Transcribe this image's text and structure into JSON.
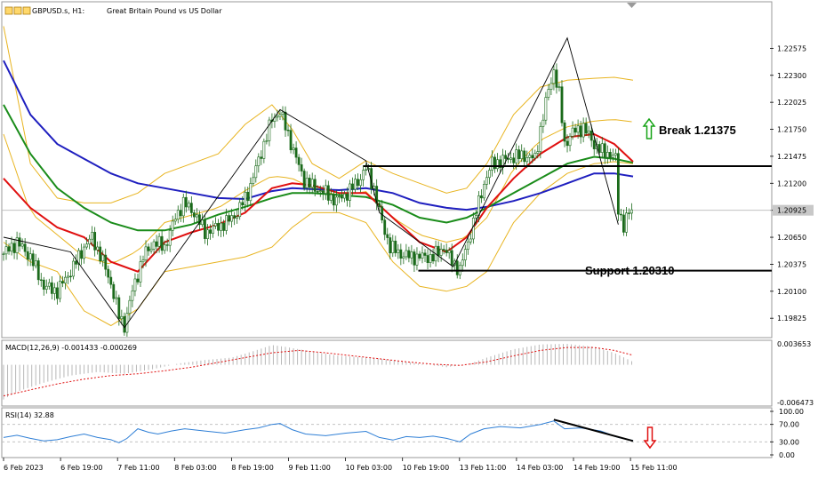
{
  "chart_data": {
    "type": "candlestick",
    "header": {
      "symbol": "GBPUSD.s, H1:",
      "description": "Great Britain Pound vs US Dollar"
    },
    "price_axis": {
      "ticks": [
        "1.22575",
        "1.22300",
        "1.22025",
        "1.21750",
        "1.21475",
        "1.21200",
        "1.20925",
        "1.20650",
        "1.20375",
        "1.20100",
        "1.19825"
      ],
      "ylim": [
        1.197,
        1.2285
      ],
      "current_price": "1.20925",
      "current_value": 1.20925
    },
    "time_axis": {
      "labels": [
        "6 Feb 2023",
        "6 Feb 19:00",
        "7 Feb 11:00",
        "8 Feb 03:00",
        "8 Feb 19:00",
        "9 Feb 11:00",
        "10 Feb 03:00",
        "10 Feb 19:00",
        "13 Feb 11:00",
        "14 Feb 03:00",
        "14 Feb 19:00",
        "15 Feb 11:00"
      ]
    },
    "close_path": [
      [
        0,
        1.2048
      ],
      [
        10,
        1.206
      ],
      [
        20,
        1.2045
      ],
      [
        30,
        1.2015
      ],
      [
        40,
        1.201
      ],
      [
        52,
        1.2035
      ],
      [
        60,
        1.2055
      ],
      [
        66,
        1.2065
      ],
      [
        74,
        1.204
      ],
      [
        80,
        1.2018
      ],
      [
        86,
        1.1985
      ],
      [
        90,
        1.1975
      ],
      [
        96,
        1.201
      ],
      [
        104,
        1.2045
      ],
      [
        112,
        1.206
      ],
      [
        120,
        1.2055
      ],
      [
        128,
        1.2085
      ],
      [
        134,
        1.21
      ],
      [
        142,
        1.209
      ],
      [
        150,
        1.207
      ],
      [
        158,
        1.2075
      ],
      [
        166,
        1.208
      ],
      [
        174,
        1.209
      ],
      [
        182,
        1.211
      ],
      [
        188,
        1.2135
      ],
      [
        194,
        1.216
      ],
      [
        200,
        1.2185
      ],
      [
        206,
        1.2193
      ],
      [
        212,
        1.217
      ],
      [
        218,
        1.2145
      ],
      [
        224,
        1.2123
      ],
      [
        232,
        1.2115
      ],
      [
        240,
        1.211
      ],
      [
        248,
        1.2102
      ],
      [
        256,
        1.211
      ],
      [
        264,
        1.2122
      ],
      [
        270,
        1.2135
      ],
      [
        276,
        1.2115
      ],
      [
        282,
        1.208
      ],
      [
        288,
        1.2055
      ],
      [
        296,
        1.2048
      ],
      [
        304,
        1.2045
      ],
      [
        312,
        1.2045
      ],
      [
        320,
        1.2045
      ],
      [
        328,
        1.2055
      ],
      [
        334,
        1.204
      ],
      [
        340,
        1.2032
      ],
      [
        346,
        1.206
      ],
      [
        352,
        1.209
      ],
      [
        358,
        1.212
      ],
      [
        364,
        1.214
      ],
      [
        372,
        1.2143
      ],
      [
        380,
        1.2147
      ],
      [
        388,
        1.2148
      ],
      [
        396,
        1.2145
      ],
      [
        400,
        1.2175
      ],
      [
        406,
        1.2215
      ],
      [
        410,
        1.2235
      ],
      [
        414,
        1.221
      ],
      [
        418,
        1.216
      ],
      [
        424,
        1.2172
      ],
      [
        432,
        1.2177
      ],
      [
        440,
        1.216
      ],
      [
        446,
        1.2152
      ],
      [
        452,
        1.215
      ],
      [
        456,
        1.2145
      ],
      [
        458,
        1.2092
      ],
      [
        462,
        1.2078
      ],
      [
        466,
        1.209
      ],
      [
        469,
        1.2093
      ]
    ],
    "zigzag": [
      [
        0,
        1.2065
      ],
      [
        50,
        1.205
      ],
      [
        90,
        1.1973
      ],
      [
        206,
        1.2195
      ],
      [
        270,
        1.2143
      ],
      [
        280,
        1.209
      ],
      [
        335,
        1.2035
      ],
      [
        420,
        1.2268
      ],
      [
        458,
        1.2078
      ]
    ],
    "indicators": {
      "sma200": [
        [
          0,
          1.2245
        ],
        [
          20,
          1.219
        ],
        [
          40,
          1.216
        ],
        [
          60,
          1.2145
        ],
        [
          80,
          1.213
        ],
        [
          100,
          1.212
        ],
        [
          120,
          1.2115
        ],
        [
          140,
          1.211
        ],
        [
          160,
          1.2105
        ],
        [
          180,
          1.2104
        ],
        [
          200,
          1.2112
        ],
        [
          215,
          1.2115
        ],
        [
          230,
          1.2114
        ],
        [
          250,
          1.2113
        ],
        [
          270,
          1.2115
        ],
        [
          290,
          1.211
        ],
        [
          310,
          1.21
        ],
        [
          330,
          1.2095
        ],
        [
          345,
          1.2093
        ],
        [
          360,
          1.2096
        ],
        [
          380,
          1.2102
        ],
        [
          400,
          1.211
        ],
        [
          420,
          1.212
        ],
        [
          440,
          1.213
        ],
        [
          455,
          1.213
        ],
        [
          469,
          1.2127
        ]
      ],
      "sma50": [
        [
          0,
          1.22
        ],
        [
          20,
          1.215
        ],
        [
          40,
          1.2115
        ],
        [
          60,
          1.2095
        ],
        [
          80,
          1.208
        ],
        [
          100,
          1.2072
        ],
        [
          120,
          1.2072
        ],
        [
          140,
          1.2078
        ],
        [
          160,
          1.2088
        ],
        [
          180,
          1.2096
        ],
        [
          200,
          1.2105
        ],
        [
          215,
          1.211
        ],
        [
          230,
          1.211
        ],
        [
          250,
          1.2108
        ],
        [
          270,
          1.2106
        ],
        [
          290,
          1.2098
        ],
        [
          310,
          1.2085
        ],
        [
          330,
          1.208
        ],
        [
          345,
          1.2085
        ],
        [
          360,
          1.2095
        ],
        [
          380,
          1.211
        ],
        [
          400,
          1.2125
        ],
        [
          420,
          1.214
        ],
        [
          440,
          1.2147
        ],
        [
          455,
          1.2145
        ],
        [
          469,
          1.2141
        ]
      ],
      "sma20": [
        [
          0,
          1.2125
        ],
        [
          20,
          1.2095
        ],
        [
          40,
          1.2075
        ],
        [
          60,
          1.2065
        ],
        [
          80,
          1.204
        ],
        [
          100,
          1.203
        ],
        [
          120,
          1.206
        ],
        [
          140,
          1.207
        ],
        [
          160,
          1.2078
        ],
        [
          180,
          1.209
        ],
        [
          200,
          1.2115
        ],
        [
          215,
          1.212
        ],
        [
          230,
          1.2118
        ],
        [
          250,
          1.211
        ],
        [
          270,
          1.211
        ],
        [
          290,
          1.2085
        ],
        [
          310,
          1.206
        ],
        [
          330,
          1.205
        ],
        [
          345,
          1.2065
        ],
        [
          360,
          1.2095
        ],
        [
          380,
          1.2125
        ],
        [
          400,
          1.215
        ],
        [
          420,
          1.2167
        ],
        [
          440,
          1.217
        ],
        [
          455,
          1.216
        ],
        [
          469,
          1.2142
        ]
      ],
      "bb_upper": [
        [
          0,
          1.228
        ],
        [
          20,
          1.214
        ],
        [
          40,
          1.2105
        ],
        [
          60,
          1.21
        ],
        [
          80,
          1.21
        ],
        [
          100,
          1.211
        ],
        [
          120,
          1.213
        ],
        [
          140,
          1.214
        ],
        [
          160,
          1.215
        ],
        [
          180,
          1.218
        ],
        [
          200,
          1.22
        ],
        [
          215,
          1.2175
        ],
        [
          230,
          1.214
        ],
        [
          250,
          1.2125
        ],
        [
          270,
          1.2143
        ],
        [
          290,
          1.213
        ],
        [
          310,
          1.212
        ],
        [
          330,
          1.211
        ],
        [
          345,
          1.2115
        ],
        [
          360,
          1.214
        ],
        [
          380,
          1.219
        ],
        [
          400,
          1.2218
        ],
        [
          420,
          1.2225
        ],
        [
          440,
          1.2227
        ],
        [
          455,
          1.2228
        ],
        [
          469,
          1.2225
        ]
      ],
      "bb_lower": [
        [
          0,
          1.206
        ],
        [
          20,
          1.204
        ],
        [
          40,
          1.203
        ],
        [
          60,
          1.199
        ],
        [
          80,
          1.1975
        ],
        [
          100,
          1.1992
        ],
        [
          120,
          1.203
        ],
        [
          140,
          1.2035
        ],
        [
          160,
          1.204
        ],
        [
          180,
          1.2045
        ],
        [
          200,
          1.2055
        ],
        [
          215,
          1.2075
        ],
        [
          230,
          1.209
        ],
        [
          250,
          1.209
        ],
        [
          270,
          1.208
        ],
        [
          290,
          1.204
        ],
        [
          310,
          1.2015
        ],
        [
          330,
          1.201
        ],
        [
          345,
          1.2015
        ],
        [
          360,
          1.203
        ],
        [
          380,
          1.208
        ],
        [
          400,
          1.211
        ],
        [
          420,
          1.213
        ],
        [
          440,
          1.214
        ],
        [
          455,
          1.2142
        ],
        [
          469,
          1.214
        ]
      ]
    },
    "levels": [
      {
        "name": "resistance",
        "price": 1.21375,
        "from": 268,
        "to": 470,
        "label": "Break 1.21375"
      },
      {
        "name": "support",
        "price": 1.2031,
        "from": 309,
        "to": 470,
        "label": "Support 1.20310"
      }
    ],
    "macd": {
      "label": "MACD(12,26,9) -0.001433 -0.000269",
      "axis_labels": [
        "0.003653",
        "-0.006473"
      ],
      "ylim": [
        -0.0066,
        0.0038
      ],
      "histogram": [
        [
          0,
          -0.0058
        ],
        [
          10,
          -0.0045
        ],
        [
          30,
          -0.003
        ],
        [
          50,
          -0.0018
        ],
        [
          70,
          -0.0012
        ],
        [
          90,
          -0.0015
        ],
        [
          110,
          -0.0008
        ],
        [
          130,
          0.0002
        ],
        [
          150,
          0.0008
        ],
        [
          170,
          0.0012
        ],
        [
          185,
          0.0022
        ],
        [
          200,
          0.0033
        ],
        [
          210,
          0.003
        ],
        [
          230,
          0.0022
        ],
        [
          250,
          0.0015
        ],
        [
          270,
          0.0012
        ],
        [
          290,
          0.0008
        ],
        [
          310,
          0.0002
        ],
        [
          330,
          -0.0004
        ],
        [
          345,
          0.0
        ],
        [
          360,
          0.0012
        ],
        [
          380,
          0.0026
        ],
        [
          400,
          0.0034
        ],
        [
          420,
          0.0035
        ],
        [
          440,
          0.003
        ],
        [
          455,
          0.002
        ],
        [
          469,
          0.0005
        ]
      ],
      "signal": [
        [
          0,
          -0.0052
        ],
        [
          20,
          -0.0042
        ],
        [
          40,
          -0.0032
        ],
        [
          60,
          -0.0024
        ],
        [
          80,
          -0.0018
        ],
        [
          100,
          -0.0015
        ],
        [
          120,
          -0.001
        ],
        [
          140,
          -0.0004
        ],
        [
          160,
          0.0004
        ],
        [
          180,
          0.0012
        ],
        [
          200,
          0.002
        ],
        [
          220,
          0.0024
        ],
        [
          240,
          0.002
        ],
        [
          260,
          0.0015
        ],
        [
          280,
          0.001
        ],
        [
          300,
          0.0005
        ],
        [
          320,
          0.0001
        ],
        [
          340,
          -0.0001
        ],
        [
          360,
          0.0005
        ],
        [
          380,
          0.0015
        ],
        [
          400,
          0.0024
        ],
        [
          420,
          0.0029
        ],
        [
          440,
          0.0029
        ],
        [
          455,
          0.0024
        ],
        [
          469,
          0.0016
        ]
      ]
    },
    "rsi": {
      "label": "RSI(14) 32.88",
      "ticks": [
        "100.00",
        "70.00",
        "30.00",
        "0.00"
      ],
      "tick_values": [
        100,
        70,
        30,
        0
      ],
      "line": [
        [
          0,
          40
        ],
        [
          10,
          45
        ],
        [
          20,
          38
        ],
        [
          30,
          32
        ],
        [
          40,
          35
        ],
        [
          50,
          42
        ],
        [
          60,
          48
        ],
        [
          70,
          40
        ],
        [
          80,
          35
        ],
        [
          86,
          28
        ],
        [
          92,
          38
        ],
        [
          100,
          60
        ],
        [
          108,
          52
        ],
        [
          115,
          48
        ],
        [
          125,
          55
        ],
        [
          135,
          60
        ],
        [
          150,
          55
        ],
        [
          165,
          50
        ],
        [
          180,
          58
        ],
        [
          190,
          62
        ],
        [
          200,
          70
        ],
        [
          206,
          72
        ],
        [
          215,
          58
        ],
        [
          225,
          48
        ],
        [
          240,
          44
        ],
        [
          255,
          50
        ],
        [
          270,
          54
        ],
        [
          280,
          40
        ],
        [
          290,
          34
        ],
        [
          300,
          42
        ],
        [
          310,
          40
        ],
        [
          320,
          43
        ],
        [
          330,
          38
        ],
        [
          340,
          30
        ],
        [
          348,
          48
        ],
        [
          358,
          60
        ],
        [
          370,
          65
        ],
        [
          385,
          62
        ],
        [
          400,
          70
        ],
        [
          410,
          78
        ],
        [
          418,
          60
        ],
        [
          430,
          62
        ],
        [
          445,
          55
        ],
        [
          458,
          40
        ],
        [
          469,
          33
        ]
      ],
      "divergence": [
        [
          410,
          81
        ],
        [
          469,
          32
        ]
      ]
    },
    "annotations": {
      "break_label": "Break 1.21375",
      "support_label": "Support 1.20310"
    },
    "colors": {
      "sma200": "#1f1fbf",
      "sma50": "#1a8c1a",
      "sma20": "#e01010",
      "bollinger": "#e8b420",
      "candle": "#1a6a1a",
      "macd_hist": "#b8b8b8",
      "macd_signal": "#e01010",
      "rsi": "#2f7fd6",
      "up_arrow": "#16a316",
      "down_arrow": "#e01010"
    }
  }
}
